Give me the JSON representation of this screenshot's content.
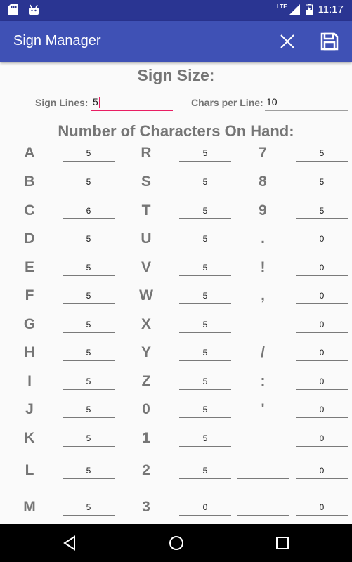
{
  "status_bar": {
    "time": "11:17",
    "network": "LTE"
  },
  "app_bar": {
    "title": "Sign Manager",
    "close_icon": "close-icon",
    "save_icon": "save-icon"
  },
  "sign_size": {
    "heading": "Sign Size:",
    "lines_label": "Sign Lines:",
    "lines_value": "5",
    "chars_label": "Chars per Line:",
    "chars_value": "10"
  },
  "characters": {
    "heading": "Number of Characters On Hand:",
    "col1": [
      {
        "char": "A",
        "count": "5"
      },
      {
        "char": "B",
        "count": "5"
      },
      {
        "char": "C",
        "count": "6"
      },
      {
        "char": "D",
        "count": "5"
      },
      {
        "char": "E",
        "count": "5"
      },
      {
        "char": "F",
        "count": "5"
      },
      {
        "char": "G",
        "count": "5"
      },
      {
        "char": "H",
        "count": "5"
      },
      {
        "char": "I",
        "count": "5"
      },
      {
        "char": "J",
        "count": "5"
      },
      {
        "char": "K",
        "count": "5"
      },
      {
        "char": "L",
        "count": "5"
      },
      {
        "char": "M",
        "count": "5"
      }
    ],
    "col2": [
      {
        "char": "R",
        "count": "5"
      },
      {
        "char": "S",
        "count": "5"
      },
      {
        "char": "T",
        "count": "5"
      },
      {
        "char": "U",
        "count": "5"
      },
      {
        "char": "V",
        "count": "5"
      },
      {
        "char": "W",
        "count": "5"
      },
      {
        "char": "X",
        "count": "5"
      },
      {
        "char": "Y",
        "count": "5"
      },
      {
        "char": "Z",
        "count": "5"
      },
      {
        "char": "0",
        "count": "5"
      },
      {
        "char": "1",
        "count": "5"
      },
      {
        "char": "2",
        "count": "5"
      },
      {
        "char": "3",
        "count": "0"
      }
    ],
    "col3": [
      {
        "char": "7",
        "count": "5"
      },
      {
        "char": "8",
        "count": "5"
      },
      {
        "char": "9",
        "count": "5"
      },
      {
        "char": ".",
        "count": "0"
      },
      {
        "char": "!",
        "count": "0"
      },
      {
        "char": ",",
        "count": "0"
      },
      {
        "char": "",
        "count": "0"
      },
      {
        "char": "/",
        "count": "0"
      },
      {
        "char": ":",
        "count": "0"
      },
      {
        "char": "'",
        "count": "0"
      },
      {
        "char": "",
        "count": "0"
      },
      {
        "char": "",
        "count": "0"
      },
      {
        "char": "",
        "count": "0"
      }
    ]
  },
  "nav_bar": {
    "back_icon": "back-icon",
    "home_icon": "home-icon",
    "recents_icon": "recents-icon"
  }
}
